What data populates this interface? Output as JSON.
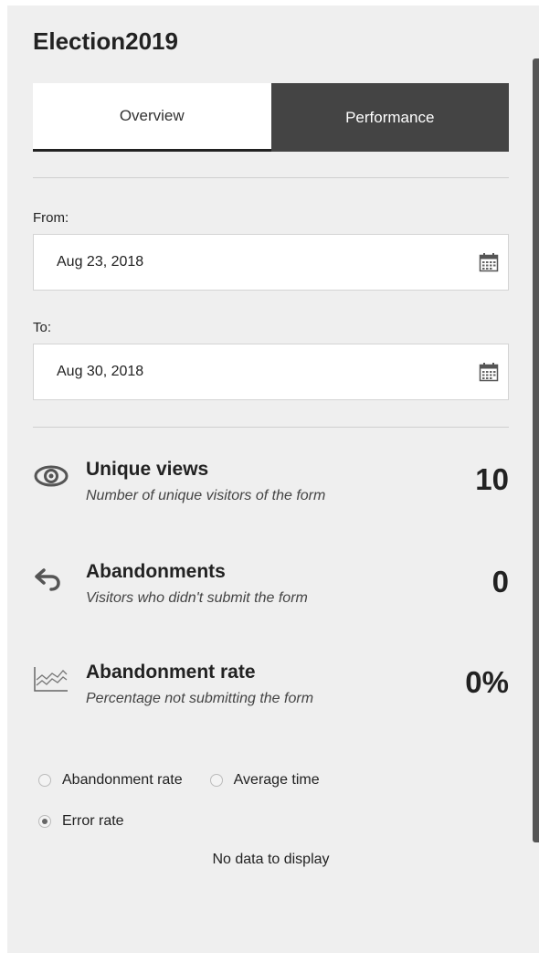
{
  "form": {
    "title": "Election2019"
  },
  "tabs": [
    {
      "label": "Overview",
      "active": false
    },
    {
      "label": "Performance",
      "active": true
    }
  ],
  "date_range": {
    "from_label": "From:",
    "from_value": "Aug 23, 2018",
    "to_label": "To:",
    "to_value": "Aug 30, 2018",
    "picker_icon": "calendar-icon"
  },
  "metrics": [
    {
      "icon": "eye-icon",
      "name": "Unique views",
      "description": "Number of unique visitors of the form",
      "value": "10"
    },
    {
      "icon": "undo-arrow-icon",
      "name": "Abandonments",
      "description": "Visitors who didn't submit the form",
      "value": "0"
    },
    {
      "icon": "line-chart-icon",
      "name": "Abandonment rate",
      "description": "Percentage not submitting the form",
      "value": "0%"
    }
  ],
  "chart_options": [
    {
      "label": "Abandonment rate",
      "selected": false
    },
    {
      "label": "Average time",
      "selected": false
    },
    {
      "label": "Error rate",
      "selected": true
    }
  ],
  "chart": {
    "empty_message": "No data to display"
  },
  "colors": {
    "panel_bg": "#efefef",
    "active_tab_bg": "#444444",
    "scrollbar": "#555555"
  }
}
